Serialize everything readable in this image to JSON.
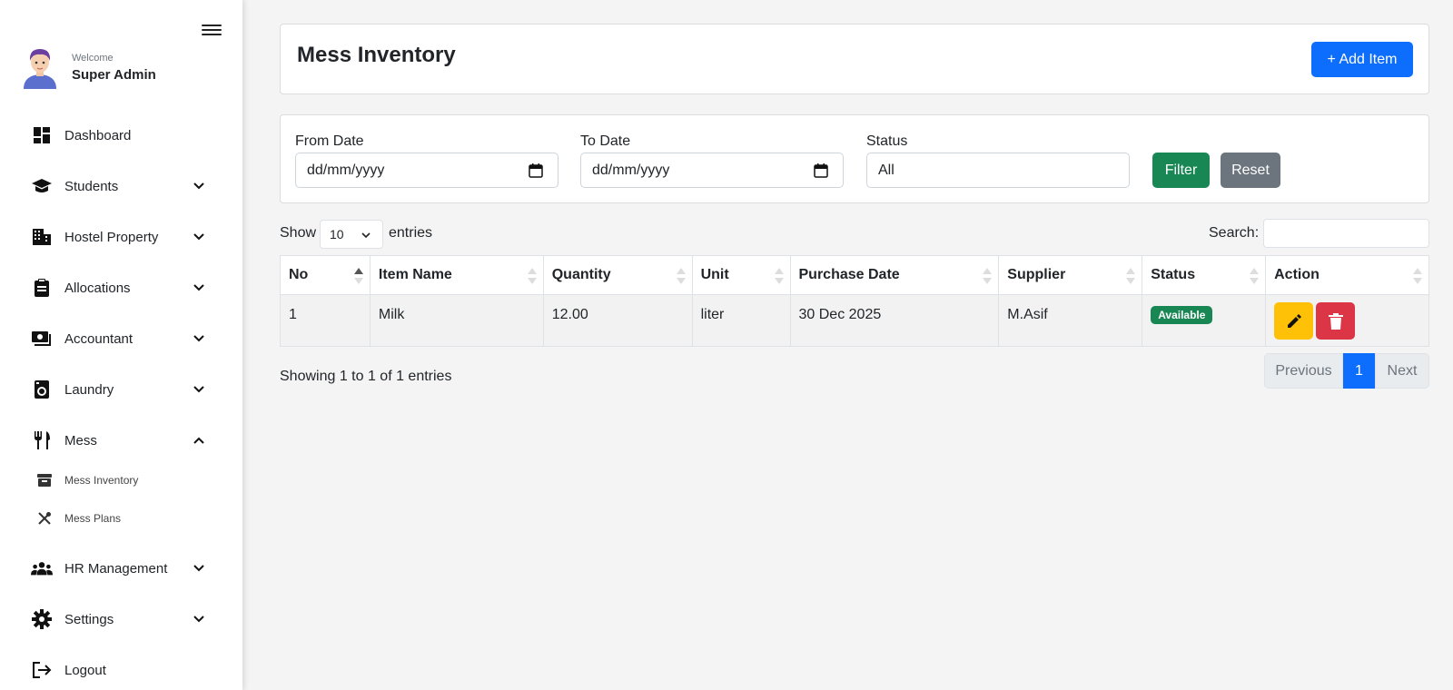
{
  "sidebar": {
    "welcome": "Welcome",
    "user_name": "Super Admin",
    "items": [
      {
        "label": "Dashboard"
      },
      {
        "label": "Students"
      },
      {
        "label": "Hostel Property"
      },
      {
        "label": "Allocations"
      },
      {
        "label": "Accountant"
      },
      {
        "label": "Laundry"
      },
      {
        "label": "Mess"
      },
      {
        "label": "HR Management"
      },
      {
        "label": "Settings"
      },
      {
        "label": "Logout"
      }
    ],
    "mess_sub": [
      {
        "label": "Mess Inventory"
      },
      {
        "label": "Mess Plans"
      }
    ]
  },
  "header": {
    "title": "Mess Inventory",
    "add_button": "+ Add Item"
  },
  "filters": {
    "from_label": "From Date",
    "from_value": "dd/mm/yyyy",
    "to_label": "To Date",
    "to_value": "dd/mm/yyyy",
    "status_label": "Status",
    "status_value": "All",
    "filter_button": "Filter",
    "reset_button": "Reset"
  },
  "datatable": {
    "show_label": "Show",
    "entries_value": "10",
    "entries_label": "entries",
    "search_label": "Search:",
    "columns": [
      "No",
      "Item Name",
      "Quantity",
      "Unit",
      "Purchase Date",
      "Supplier",
      "Status",
      "Action"
    ],
    "rows": [
      {
        "no": "1",
        "item": "Milk",
        "quantity": "12.00",
        "unit": "liter",
        "date": "30 Dec 2025",
        "supplier": "M.Asif",
        "status": "Available"
      }
    ],
    "info": "Showing 1 to 1 of 1 entries",
    "prev": "Previous",
    "page": "1",
    "next": "Next"
  },
  "colors": {
    "primary": "#0d6efd",
    "success": "#198754",
    "secondary": "#6c757d",
    "warning": "#ffc107",
    "danger": "#dc3545"
  }
}
